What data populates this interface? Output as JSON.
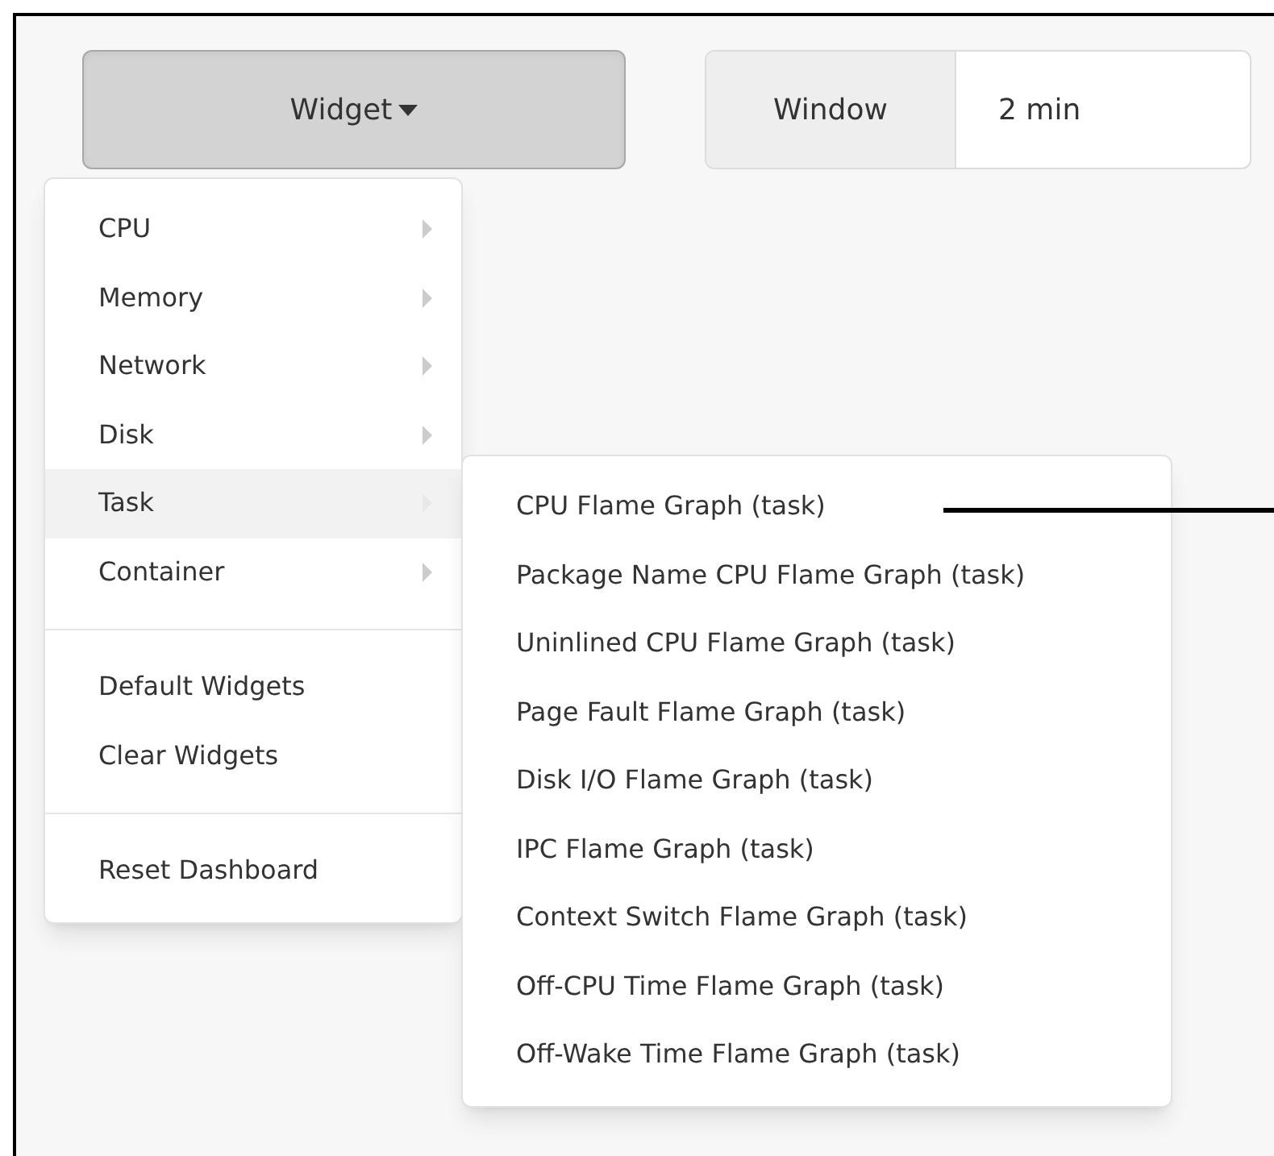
{
  "toolbar": {
    "widget_button": {
      "label": "Widget",
      "expanded": true
    },
    "window": {
      "label": "Window",
      "value": "2 min"
    }
  },
  "menu": {
    "groups": [
      [
        {
          "label": "CPU",
          "kind": "submenu",
          "selected": false
        },
        {
          "label": "Memory",
          "kind": "submenu",
          "selected": false
        },
        {
          "label": "Network",
          "kind": "submenu",
          "selected": false
        },
        {
          "label": "Disk",
          "kind": "submenu",
          "selected": false
        },
        {
          "label": "Task",
          "kind": "submenu",
          "selected": true
        },
        {
          "label": "Container",
          "kind": "submenu",
          "selected": false
        }
      ],
      [
        {
          "label": "Default Widgets",
          "kind": "action",
          "selected": false
        },
        {
          "label": "Clear Widgets",
          "kind": "action",
          "selected": false
        }
      ],
      [
        {
          "label": "Reset Dashboard",
          "kind": "action",
          "selected": false
        }
      ]
    ]
  },
  "submenu": {
    "items": [
      {
        "label": "CPU Flame Graph (task)"
      },
      {
        "label": "Package Name CPU Flame Graph (task)"
      },
      {
        "label": "Uninlined CPU Flame Graph (task)"
      },
      {
        "label": "Page Fault Flame Graph (task)"
      },
      {
        "label": "Disk I/O Flame Graph (task)"
      },
      {
        "label": "IPC Flame Graph (task)"
      },
      {
        "label": "Context Switch Flame Graph (task)"
      },
      {
        "label": "Off-CPU Time Flame Graph (task)"
      },
      {
        "label": "Off-Wake Time Flame Graph (task)"
      }
    ]
  },
  "annotation": {
    "pointer": true
  }
}
